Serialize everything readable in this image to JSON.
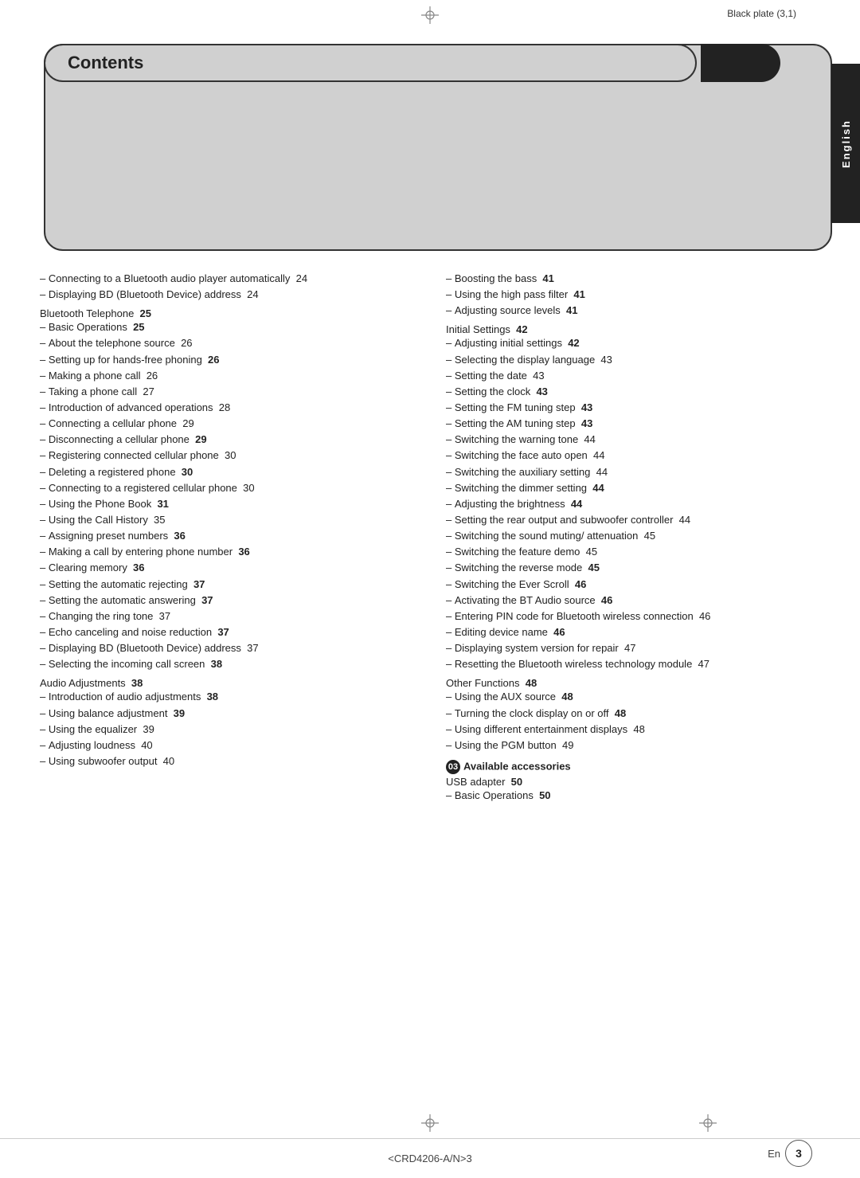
{
  "page": {
    "plate_text": "Black plate (3,1)",
    "bottom_code": "<CRD4206-A/N>3",
    "page_en": "En",
    "page_num": "3"
  },
  "header": {
    "title": "Contents"
  },
  "right_tab": {
    "label": "English"
  },
  "col_left": {
    "entries": [
      {
        "type": "sub",
        "text": "Connecting to a Bluetooth audio player automatically",
        "page": "24"
      },
      {
        "type": "sub",
        "text": "Displaying BD (Bluetooth Device) address",
        "page": "24"
      },
      {
        "type": "section",
        "text": "Bluetooth Telephone",
        "page": "25"
      },
      {
        "type": "sub",
        "text": "Basic Operations",
        "page": "25",
        "bold_page": true
      },
      {
        "type": "sub",
        "text": "About the telephone source",
        "page": "26"
      },
      {
        "type": "sub",
        "text": "Setting up for hands-free phoning",
        "page": "26",
        "bold_page": true
      },
      {
        "type": "sub",
        "text": "Making a phone call",
        "page": "26"
      },
      {
        "type": "sub",
        "text": "Taking a phone call",
        "page": "27"
      },
      {
        "type": "sub",
        "text": "Introduction of advanced operations",
        "page": "28"
      },
      {
        "type": "sub",
        "text": "Connecting a cellular phone",
        "page": "29"
      },
      {
        "type": "sub",
        "text": "Disconnecting a cellular phone",
        "page": "29",
        "bold_page": true
      },
      {
        "type": "sub",
        "text": "Registering connected cellular phone",
        "page": "30"
      },
      {
        "type": "sub",
        "text": "Deleting a registered phone",
        "page": "30",
        "bold_page": true
      },
      {
        "type": "sub",
        "text": "Connecting to a registered cellular phone",
        "page": "30"
      },
      {
        "type": "sub",
        "text": "Using the Phone Book",
        "page": "31",
        "bold_page": true
      },
      {
        "type": "sub",
        "text": "Using the Call History",
        "page": "35"
      },
      {
        "type": "sub",
        "text": "Assigning preset numbers",
        "page": "36",
        "bold_page": true
      },
      {
        "type": "sub",
        "text": "Making a call by entering phone number",
        "page": "36",
        "bold_page": true
      },
      {
        "type": "sub",
        "text": "Clearing memory",
        "page": "36",
        "bold_page": true
      },
      {
        "type": "sub",
        "text": "Setting the automatic rejecting",
        "page": "37",
        "bold_page": true
      },
      {
        "type": "sub",
        "text": "Setting the automatic answering",
        "page": "37",
        "bold_page": true
      },
      {
        "type": "sub",
        "text": "Changing the ring tone",
        "page": "37"
      },
      {
        "type": "sub",
        "text": "Echo canceling and noise reduction",
        "page": "37",
        "bold_page": true
      },
      {
        "type": "sub",
        "text": "Displaying BD (Bluetooth Device) address",
        "page": "37"
      },
      {
        "type": "sub",
        "text": "Selecting the incoming call screen",
        "page": "38",
        "bold_page": true
      },
      {
        "type": "section",
        "text": "Audio Adjustments",
        "page": "38"
      },
      {
        "type": "sub",
        "text": "Introduction of audio adjustments",
        "page": "38",
        "bold_page": true
      },
      {
        "type": "sub",
        "text": "Using balance adjustment",
        "page": "39",
        "bold_page": true
      },
      {
        "type": "sub",
        "text": "Using the equalizer",
        "page": "39"
      },
      {
        "type": "sub",
        "text": "Adjusting loudness",
        "page": "40"
      },
      {
        "type": "sub",
        "text": "Using subwoofer output",
        "page": "40"
      }
    ]
  },
  "col_right": {
    "entries": [
      {
        "type": "sub",
        "text": "Boosting the bass",
        "page": "41",
        "bold_page": true
      },
      {
        "type": "sub",
        "text": "Using the high pass filter",
        "page": "41",
        "bold_page": true
      },
      {
        "type": "sub",
        "text": "Adjusting source levels",
        "page": "41",
        "bold_page": true
      },
      {
        "type": "section",
        "text": "Initial Settings",
        "page": "42"
      },
      {
        "type": "sub",
        "text": "Adjusting initial settings",
        "page": "42",
        "bold_page": true
      },
      {
        "type": "sub",
        "text": "Selecting the display language",
        "page": "43"
      },
      {
        "type": "sub",
        "text": "Setting the date",
        "page": "43"
      },
      {
        "type": "sub",
        "text": "Setting the clock",
        "page": "43",
        "bold_page": true
      },
      {
        "type": "sub",
        "text": "Setting the FM tuning step",
        "page": "43",
        "bold_page": true
      },
      {
        "type": "sub",
        "text": "Setting the AM tuning step",
        "page": "43",
        "bold_page": true
      },
      {
        "type": "sub",
        "text": "Switching the warning tone",
        "page": "44"
      },
      {
        "type": "sub",
        "text": "Switching the face auto open",
        "page": "44"
      },
      {
        "type": "sub",
        "text": "Switching the auxiliary setting",
        "page": "44"
      },
      {
        "type": "sub",
        "text": "Switching the dimmer setting",
        "page": "44",
        "bold_page": true
      },
      {
        "type": "sub",
        "text": "Adjusting the brightness",
        "page": "44",
        "bold_page": true
      },
      {
        "type": "sub",
        "text": "Setting the rear output and subwoofer controller",
        "page": "44"
      },
      {
        "type": "sub",
        "text": "Switching the sound muting/ attenuation",
        "page": "45"
      },
      {
        "type": "sub",
        "text": "Switching the feature demo",
        "page": "45"
      },
      {
        "type": "sub",
        "text": "Switching the reverse mode",
        "page": "45",
        "bold_page": true
      },
      {
        "type": "sub",
        "text": "Switching the Ever Scroll",
        "page": "46",
        "bold_page": true
      },
      {
        "type": "sub",
        "text": "Activating the BT Audio source",
        "page": "46",
        "bold_page": true
      },
      {
        "type": "sub",
        "text": "Entering PIN code for Bluetooth wireless connection",
        "page": "46"
      },
      {
        "type": "sub",
        "text": "Editing device name",
        "page": "46",
        "bold_page": true
      },
      {
        "type": "sub",
        "text": "Displaying system version for repair",
        "page": "47"
      },
      {
        "type": "sub",
        "text": "Resetting the Bluetooth wireless technology module",
        "page": "47"
      },
      {
        "type": "section",
        "text": "Other Functions",
        "page": "48"
      },
      {
        "type": "sub",
        "text": "Using the AUX source",
        "page": "48",
        "bold_page": true
      },
      {
        "type": "sub",
        "text": "Turning the clock display on or off",
        "page": "48",
        "bold_page": true
      },
      {
        "type": "sub",
        "text": "Using different entertainment displays",
        "page": "48"
      },
      {
        "type": "sub",
        "text": "Using the PGM button",
        "page": "49"
      },
      {
        "type": "special_section",
        "icon": "03",
        "text": "Available accessories"
      },
      {
        "type": "section2",
        "text": "USB adapter",
        "page": "50"
      },
      {
        "type": "sub",
        "text": "Basic Operations",
        "page": "50",
        "bold_page": true
      }
    ]
  }
}
